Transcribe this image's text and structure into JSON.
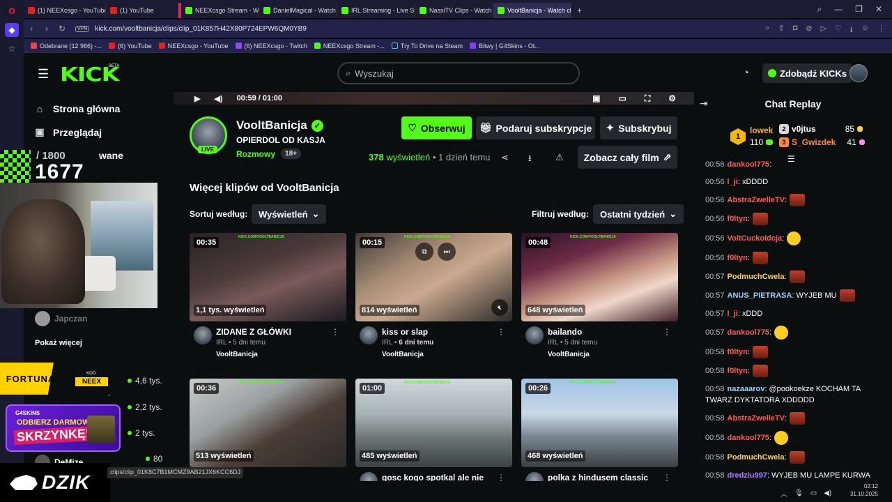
{
  "browser": {
    "tabs": [
      {
        "label": "(1) NEEXcsgo - YouTube",
        "icon": "youtube"
      },
      {
        "label": "(1) YouTube",
        "icon": "youtube"
      },
      {
        "label": "NEEXcsgo Stream - Watch",
        "icon": "kick"
      },
      {
        "label": "DanielMagical - Watch the",
        "icon": "kick"
      },
      {
        "label": "IRL Streaming - Live Strea",
        "icon": "kick"
      },
      {
        "label": "NassiTV Clips - Watch Live",
        "icon": "kick"
      },
      {
        "label": "VooltBanicja - Watch clips",
        "icon": "kick",
        "active": true
      }
    ],
    "new_tab": "+",
    "vpn": "VPN",
    "url": "kick.com/vooltbanicja/clips/clip_01K857H42X80P724EPW6QM0YB9",
    "bookmarks": [
      "Odebrane (12 966) -...",
      "(6) YouTube",
      "NEEXcsgo - YouTube",
      "(6) NEEXcsgo - Twitch",
      "NEEXcsgo Stream -...",
      "Try To Drive na Steam",
      "Bitwy | G4Skins - Ot..."
    ],
    "status_url": "clips/clip_01K8C7B1MCMZ9AB21JX6KCC6DJ"
  },
  "kick_header": {
    "logo": "KICK",
    "beta": "BETA",
    "search_placeholder": "Wyszukaj",
    "kicks_button": "Zdobądź KICKs"
  },
  "sidebar": {
    "links": [
      {
        "label": "Strona główna",
        "icon": "home-icon"
      },
      {
        "label": "Przeglądaj",
        "icon": "browse-icon"
      },
      {
        "label": "wane",
        "icon": "heart-icon"
      }
    ],
    "goal_total": "/ 1800",
    "goal_now": "1677",
    "japczan": "Japczan",
    "show_more": "Pokaż więcej",
    "channel_counts": [
      "4,6 tys.",
      "2,2 tys.",
      "2 tys."
    ],
    "demize": "DeMize",
    "demize_count": "80",
    "rozmowy": "Rozmowy"
  },
  "ads": {
    "fortuna_brand": "FORTUNA",
    "fortuna_kod_label": "KOD:",
    "fortuna_kod": "NEEX",
    "skins_brand": "G4SKINS",
    "skins_line1": "ODBIERZ DARMOWĄ",
    "skins_line2": "SKRZYNKĘ!",
    "dzik": "DZIK"
  },
  "player": {
    "time": "00:59 / 01:00"
  },
  "channel": {
    "name": "VooltBanicja",
    "live": "LIVE",
    "clip_title": "OPIERDOL OD KASJA",
    "category": "Rozmowy",
    "age_tag": "18+",
    "follow": "Obserwuj",
    "gift": "Podaruj subskrypcje",
    "subscribe": "Subskrybuj",
    "views_count": "378",
    "views_label": "wyświetleń",
    "when": "1 dzień temu",
    "full_movie": "Zobacz cały film"
  },
  "clips_section": {
    "title": "Więcej klipów od VooltBanicja",
    "sort_label": "Sortuj według:",
    "sort_value": "Wyświetleń",
    "filter_label": "Filtruj według:",
    "filter_value": "Ostatni tydzień",
    "watermark": "KICK.COM/VOOLTBANICJA",
    "clips": [
      {
        "duration": "00:35",
        "views": "1,1 tys. wyświetleń",
        "title": "ZIDANE Z GŁÓWKI",
        "category": "IRL",
        "ago": "5 dni temu",
        "channel": "VooltBanicja"
      },
      {
        "duration": "00:15",
        "views": "814 wyświetleń",
        "title": "kiss or slap",
        "category": "IRL",
        "ago": "6 dni temu",
        "channel": "VooltBanicja"
      },
      {
        "duration": "00:48",
        "views": "648 wyświetleń",
        "title": "bailando",
        "category": "IRL",
        "ago": "5 dni temu",
        "channel": "VooltBanicja"
      },
      {
        "duration": "00:36",
        "views": "513 wyświetleń",
        "title": "",
        "category": "",
        "ago": "",
        "channel": ""
      },
      {
        "duration": "01:00",
        "views": "485 wyświetleń",
        "title": "gosc kogo spotkal ale nie",
        "category": "",
        "ago": "",
        "channel": ""
      },
      {
        "duration": "00:26",
        "views": "468 wyświetleń",
        "title": "polka z hindusem classic",
        "category": "",
        "ago": "",
        "channel": ""
      }
    ]
  },
  "chat": {
    "title": "Chat Replay",
    "leaderboard": [
      {
        "name": "lowek",
        "count": "110",
        "color": "#f5b60a",
        "rank": "1"
      },
      {
        "name": "v0jtus",
        "count": "85",
        "color": "#d9d9d9",
        "rank": "2"
      },
      {
        "name": "S_Gwizdek",
        "count": "41",
        "color": "#ff8a3d",
        "rank": "3"
      }
    ],
    "messages": [
      {
        "ts": "00:56",
        "user": "dankool775",
        "color": "#ff5a5a",
        "text": ":",
        "emote": ""
      },
      {
        "ts": "00:56",
        "user": "l_ji",
        "color": "#ff5a5a",
        "text": ": xDDDD",
        "emote": ""
      },
      {
        "ts": "00:56",
        "user": "AbstraZwelleTV",
        "color": "#ff5a5a",
        "text": ":",
        "emote": "emote"
      },
      {
        "ts": "00:56",
        "user": "f0ltyn",
        "color": "#ff5a5a",
        "text": ":",
        "emote": "emote"
      },
      {
        "ts": "00:56",
        "user": "VoltCuckoldcja",
        "color": "#ff5a5a",
        "text": ":",
        "emote": "emoji"
      },
      {
        "ts": "00:56",
        "user": "f0ltyn",
        "color": "#ff5a5a",
        "text": ":",
        "emote": "emote"
      },
      {
        "ts": "00:57",
        "user": "PodmuchCwela",
        "color": "#ffd24a",
        "text": ":",
        "emote": "emote"
      },
      {
        "ts": "00:57",
        "user": "ANUS_PIETRASA",
        "color": "#9bd1ff",
        "text": ": WYJEB MU",
        "emote": "emote"
      },
      {
        "ts": "00:57",
        "user": "l_ji",
        "color": "#ff5a5a",
        "text": ": xDDD",
        "emote": ""
      },
      {
        "ts": "00:57",
        "user": "dankool775",
        "color": "#ff5a5a",
        "text": ":",
        "emote": "emoji"
      },
      {
        "ts": "00:58",
        "user": "f0ltyn",
        "color": "#ff5a5a",
        "text": ":",
        "emote": "emote"
      },
      {
        "ts": "00:58",
        "user": "f0ltyn",
        "color": "#ff5a5a",
        "text": ":",
        "emote": "emote"
      },
      {
        "ts": "00:58",
        "user": "nazaaarov",
        "color": "#9bd1ff",
        "text": ": @pookoekze KOCHAM TA TWARZ DYKTATORA XDDDDD",
        "emote": ""
      },
      {
        "ts": "00:58",
        "user": "AbstraZwelleTV",
        "color": "#ff5a5a",
        "text": ":",
        "emote": "emote"
      },
      {
        "ts": "00:58",
        "user": "dankool775",
        "color": "#ff5a5a",
        "text": ":",
        "emote": "emoji"
      },
      {
        "ts": "00:58",
        "user": "PodmuchCwela",
        "color": "#ffd24a",
        "text": ":",
        "emote": "emote"
      },
      {
        "ts": "00:58",
        "user": "dredziu997",
        "color": "#b07cff",
        "text": ": WYJEB MU LAMPE KURWA",
        "emote": ""
      }
    ]
  },
  "taskbar": {
    "time": "02:12",
    "date": "31.10.2025"
  },
  "colors": {
    "kick_green": "#53fc18",
    "bg": "#0b0e0f",
    "button": "#24272c"
  }
}
